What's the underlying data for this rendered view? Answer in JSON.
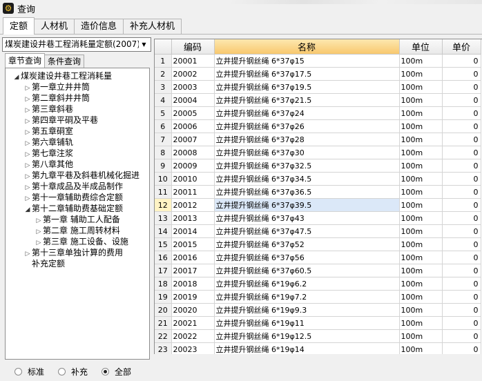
{
  "window": {
    "title": "查询"
  },
  "tabs": [
    "定额",
    "人材机",
    "造价信息",
    "补充人材机"
  ],
  "left": {
    "dropdown_value": "煤炭建设井巷工程消耗量定额(2007)",
    "subtabs": [
      "章节查询",
      "条件查询"
    ],
    "tree": [
      {
        "label": "煤炭建设井巷工程消耗量",
        "level": 0,
        "state": "open"
      },
      {
        "label": "第一章立井井筒",
        "level": 1,
        "state": "closed"
      },
      {
        "label": "第二章斜井井筒",
        "level": 1,
        "state": "closed"
      },
      {
        "label": "第三章斜巷",
        "level": 1,
        "state": "closed"
      },
      {
        "label": "第四章平硐及平巷",
        "level": 1,
        "state": "closed"
      },
      {
        "label": "第五章硐室",
        "level": 1,
        "state": "closed"
      },
      {
        "label": "第六章铺轨",
        "level": 1,
        "state": "closed"
      },
      {
        "label": "第七章注浆",
        "level": 1,
        "state": "closed"
      },
      {
        "label": "第八章其他",
        "level": 1,
        "state": "closed"
      },
      {
        "label": "第九章平巷及斜巷机械化掘进",
        "level": 1,
        "state": "closed"
      },
      {
        "label": "第十章成品及半成品制作",
        "level": 1,
        "state": "closed"
      },
      {
        "label": "第十一章辅助费综合定额",
        "level": 1,
        "state": "closed"
      },
      {
        "label": "第十二章辅助费基础定额",
        "level": 1,
        "state": "open"
      },
      {
        "label": "第一章 辅助工人配备",
        "level": 2,
        "state": "closed"
      },
      {
        "label": "第二章 施工周转材料",
        "level": 2,
        "state": "closed"
      },
      {
        "label": "第三章 施工设备、设施",
        "level": 2,
        "state": "closed"
      },
      {
        "label": "第十三章单独计算的费用",
        "level": 1,
        "state": "closed"
      },
      {
        "label": "补充定额",
        "level": 1,
        "state": "none"
      }
    ],
    "radios": [
      {
        "label": "标准",
        "checked": false
      },
      {
        "label": "补充",
        "checked": false
      },
      {
        "label": "全部",
        "checked": true
      }
    ]
  },
  "grid": {
    "headers": [
      "编码",
      "名称",
      "单位",
      "单价"
    ],
    "selected_row": 12,
    "rows": [
      {
        "n": "1",
        "code": "20001",
        "name": "立井提升钢丝绳 6*37φ15",
        "unit": "100m",
        "price": "0"
      },
      {
        "n": "2",
        "code": "20002",
        "name": "立井提升钢丝绳 6*37φ17.5",
        "unit": "100m",
        "price": "0"
      },
      {
        "n": "3",
        "code": "20003",
        "name": "立井提升钢丝绳 6*37φ19.5",
        "unit": "100m",
        "price": "0"
      },
      {
        "n": "4",
        "code": "20004",
        "name": "立井提升钢丝绳 6*37φ21.5",
        "unit": "100m",
        "price": "0"
      },
      {
        "n": "5",
        "code": "20005",
        "name": "立井提升钢丝绳 6*37φ24",
        "unit": "100m",
        "price": "0"
      },
      {
        "n": "6",
        "code": "20006",
        "name": "立井提升钢丝绳 6*37φ26",
        "unit": "100m",
        "price": "0"
      },
      {
        "n": "7",
        "code": "20007",
        "name": "立井提升钢丝绳 6*37φ28",
        "unit": "100m",
        "price": "0"
      },
      {
        "n": "8",
        "code": "20008",
        "name": "立井提升钢丝绳 6*37φ30",
        "unit": "100m",
        "price": "0"
      },
      {
        "n": "9",
        "code": "20009",
        "name": "立井提升钢丝绳 6*37φ32.5",
        "unit": "100m",
        "price": "0"
      },
      {
        "n": "10",
        "code": "20010",
        "name": "立井提升钢丝绳 6*37φ34.5",
        "unit": "100m",
        "price": "0"
      },
      {
        "n": "11",
        "code": "20011",
        "name": "立井提升钢丝绳 6*37φ36.5",
        "unit": "100m",
        "price": "0"
      },
      {
        "n": "12",
        "code": "20012",
        "name": "立井提升钢丝绳 6*37φ39.5",
        "unit": "100m",
        "price": "0"
      },
      {
        "n": "13",
        "code": "20013",
        "name": "立井提升钢丝绳 6*37φ43",
        "unit": "100m",
        "price": "0"
      },
      {
        "n": "14",
        "code": "20014",
        "name": "立井提升钢丝绳 6*37φ47.5",
        "unit": "100m",
        "price": "0"
      },
      {
        "n": "15",
        "code": "20015",
        "name": "立井提升钢丝绳 6*37φ52",
        "unit": "100m",
        "price": "0"
      },
      {
        "n": "16",
        "code": "20016",
        "name": "立井提升钢丝绳 6*37φ56",
        "unit": "100m",
        "price": "0"
      },
      {
        "n": "17",
        "code": "20017",
        "name": "立井提升钢丝绳 6*37φ60.5",
        "unit": "100m",
        "price": "0"
      },
      {
        "n": "18",
        "code": "20018",
        "name": "立井提升钢丝绳 6*19φ6.2",
        "unit": "100m",
        "price": "0"
      },
      {
        "n": "19",
        "code": "20019",
        "name": "立井提升钢丝绳 6*19φ7.2",
        "unit": "100m",
        "price": "0"
      },
      {
        "n": "20",
        "code": "20020",
        "name": "立井提升钢丝绳 6*19φ9.3",
        "unit": "100m",
        "price": "0"
      },
      {
        "n": "21",
        "code": "20021",
        "name": "立井提升钢丝绳 6*19φ11",
        "unit": "100m",
        "price": "0"
      },
      {
        "n": "22",
        "code": "20022",
        "name": "立井提升钢丝绳 6*19φ12.5",
        "unit": "100m",
        "price": "0"
      },
      {
        "n": "23",
        "code": "20023",
        "name": "立井提升钢丝绳 6*19φ14",
        "unit": "100m",
        "price": "0"
      }
    ]
  }
}
